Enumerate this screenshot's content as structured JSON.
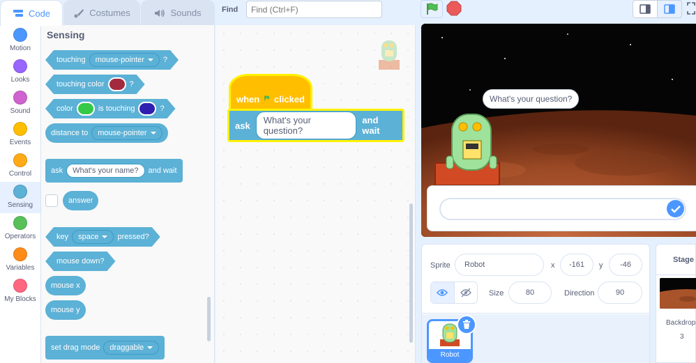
{
  "tabs": {
    "code": "Code",
    "costumes": "Costumes",
    "sounds": "Sounds"
  },
  "find": {
    "label": "Find",
    "placeholder": "Find (Ctrl+F)"
  },
  "categories": [
    {
      "label": "Motion",
      "color": "#4c97ff"
    },
    {
      "label": "Looks",
      "color": "#9966ff"
    },
    {
      "label": "Sound",
      "color": "#cf63cf"
    },
    {
      "label": "Events",
      "color": "#ffbf00"
    },
    {
      "label": "Control",
      "color": "#ffab19"
    },
    {
      "label": "Sensing",
      "color": "#5cb1d6"
    },
    {
      "label": "Operators",
      "color": "#59c059"
    },
    {
      "label": "Variables",
      "color": "#ff8c1a"
    },
    {
      "label": "My Blocks",
      "color": "#ff6680"
    }
  ],
  "palette": {
    "title": "Sensing",
    "touching": {
      "label": "touching",
      "menu": "mouse-pointer",
      "end": "?"
    },
    "touching_color": {
      "label": "touching color",
      "end": "?",
      "swatch": "#a3293f"
    },
    "color_touching": {
      "label1": "color",
      "label2": "is touching",
      "end": "?",
      "swatch1": "#35c947",
      "swatch2": "#2f1fb0"
    },
    "distance": {
      "label": "distance to",
      "menu": "mouse-pointer"
    },
    "ask": {
      "label": "ask",
      "input": "What's your name?",
      "end": "and wait"
    },
    "answer": "answer",
    "key_pressed": {
      "label": "key",
      "menu": "space",
      "end": "pressed?"
    },
    "mouse_down": "mouse down?",
    "mouse_x": "mouse x",
    "mouse_y": "mouse y",
    "drag_mode": {
      "label": "set drag mode",
      "menu": "draggable"
    }
  },
  "script": {
    "hat": {
      "when": "when",
      "clicked": "clicked"
    },
    "ask": {
      "label": "ask",
      "input": "What's your question?",
      "end": "and wait"
    }
  },
  "stage": {
    "say_bubble": "What's your question?",
    "ask_input_value": ""
  },
  "sprite_info": {
    "sprite_label": "Sprite",
    "sprite_name": "Robot",
    "x_label": "x",
    "x_value": "-161",
    "y_label": "y",
    "y_value": "-46",
    "size_label": "Size",
    "size_value": "80",
    "direction_label": "Direction",
    "direction_value": "90"
  },
  "sprites": [
    {
      "name": "Robot"
    }
  ],
  "stage_selector": {
    "title": "Stage",
    "backdrops_label": "Backdrops",
    "backdrops_count": "3"
  },
  "colors": {
    "accent": "#4c97ff",
    "sensing": "#5cb1d6",
    "events": "#ffbf00",
    "highlight": "#fff200"
  }
}
